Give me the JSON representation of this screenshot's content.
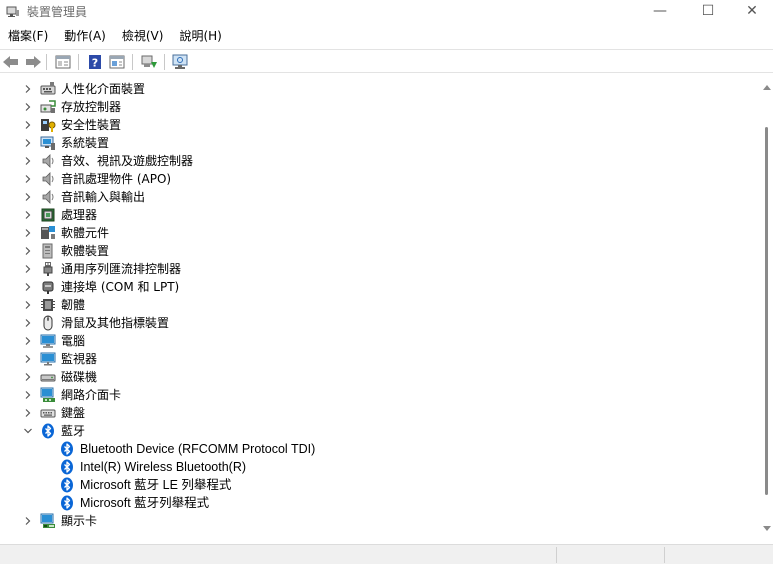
{
  "window": {
    "title": "裝置管理員",
    "minimize_glyph": "—",
    "maximize_glyph": "☐",
    "close_glyph": "✕"
  },
  "menu": [
    {
      "label": "檔案(F)"
    },
    {
      "label": "動作(A)"
    },
    {
      "label": "檢視(V)"
    },
    {
      "label": "說明(H)"
    }
  ],
  "toolbar": {
    "icons": [
      "back-arrow-icon",
      "forward-arrow-icon",
      "properties-icon",
      "help-icon",
      "view-icon",
      "update-driver-icon",
      "scan-hardware-icon"
    ]
  },
  "tree": {
    "categories": [
      {
        "label": "人性化介面裝置",
        "icon": "hid-icon",
        "expanded": false
      },
      {
        "label": "存放控制器",
        "icon": "storage-controller-icon",
        "expanded": false
      },
      {
        "label": "安全性裝置",
        "icon": "security-device-icon",
        "expanded": false
      },
      {
        "label": "系統裝置",
        "icon": "system-device-icon",
        "expanded": false
      },
      {
        "label": "音效、視訊及遊戲控制器",
        "icon": "speaker-icon",
        "expanded": false
      },
      {
        "label": "音訊處理物件 (APO)",
        "icon": "speaker-icon",
        "expanded": false
      },
      {
        "label": "音訊輸入與輸出",
        "icon": "speaker-icon",
        "expanded": false
      },
      {
        "label": "處理器",
        "icon": "processor-icon",
        "expanded": false
      },
      {
        "label": "軟體元件",
        "icon": "software-component-icon",
        "expanded": false
      },
      {
        "label": "軟體裝置",
        "icon": "software-device-icon",
        "expanded": false
      },
      {
        "label": "通用序列匯流排控制器",
        "icon": "usb-icon",
        "expanded": false
      },
      {
        "label": "連接埠 (COM 和 LPT)",
        "icon": "port-icon",
        "expanded": false
      },
      {
        "label": "韌體",
        "icon": "firmware-icon",
        "expanded": false
      },
      {
        "label": "滑鼠及其他指標裝置",
        "icon": "mouse-icon",
        "expanded": false
      },
      {
        "label": "電腦",
        "icon": "computer-icon",
        "expanded": false
      },
      {
        "label": "監視器",
        "icon": "monitor-icon",
        "expanded": false
      },
      {
        "label": "磁碟機",
        "icon": "disk-drive-icon",
        "expanded": false
      },
      {
        "label": "網路介面卡",
        "icon": "network-adapter-icon",
        "expanded": false
      },
      {
        "label": "鍵盤",
        "icon": "keyboard-icon",
        "expanded": false
      },
      {
        "label": "藍牙",
        "icon": "bluetooth-icon",
        "expanded": true,
        "children": [
          {
            "label": "Bluetooth Device (RFCOMM Protocol TDI)"
          },
          {
            "label": "Intel(R) Wireless Bluetooth(R)"
          },
          {
            "label": "Microsoft 藍牙 LE 列舉程式"
          },
          {
            "label": "Microsoft 藍牙列舉程式"
          }
        ]
      },
      {
        "label": "顯示卡",
        "icon": "display-adapter-icon",
        "expanded": false
      }
    ]
  },
  "colors": {
    "bluetooth": "#0a66d6",
    "monitor": "#2a8fd4",
    "chevron": "#555555"
  }
}
